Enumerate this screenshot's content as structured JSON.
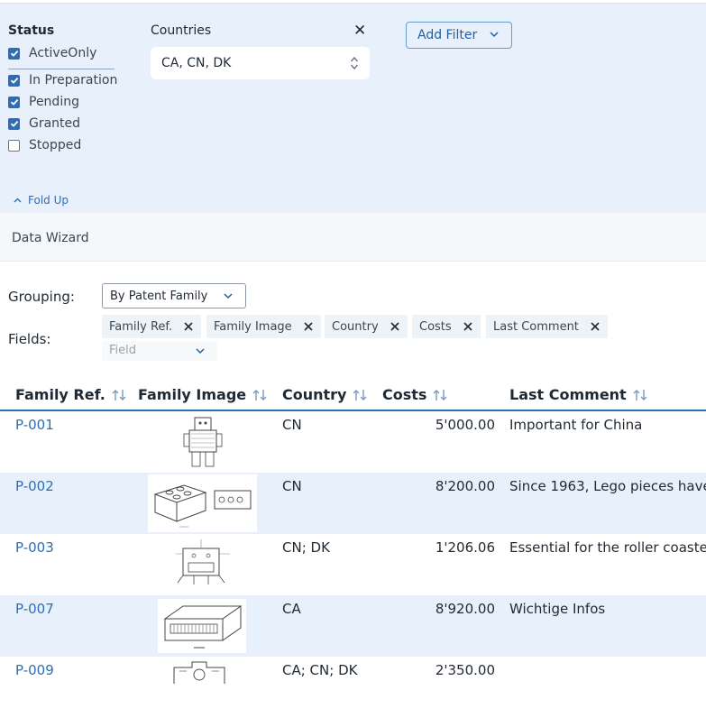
{
  "filters": {
    "status_title": "Status",
    "status_options": [
      {
        "label": "ActiveOnly",
        "checked": true
      },
      {
        "label": "In Preparation",
        "checked": true
      },
      {
        "label": "Pending",
        "checked": true
      },
      {
        "label": "Granted",
        "checked": true
      },
      {
        "label": "Stopped",
        "checked": false
      }
    ],
    "countries_title": "Countries",
    "countries_value": "CA, CN, DK",
    "add_filter_label": "Add Filter",
    "fold_up_label": "Fold Up"
  },
  "wizard": {
    "title": "Data Wizard",
    "grouping_label": "Grouping:",
    "grouping_value": "By Patent Family",
    "fields_label": "Fields:",
    "field_chips": [
      "Family Ref.",
      "Family Image",
      "Country",
      "Costs",
      "Last Comment"
    ],
    "field_placeholder": "Field"
  },
  "table": {
    "columns": [
      "Family Ref.",
      "Family Image",
      "Country",
      "Costs",
      "Last Comment"
    ],
    "rows": [
      {
        "ref": "P-001",
        "country": "CN",
        "costs": "5'000.00",
        "comment": "Important for China",
        "image": "robot-drawing"
      },
      {
        "ref": "P-002",
        "country": "CN",
        "costs": "8'200.00",
        "comment": "Since 1963, Lego pieces have",
        "image": "brick-drawing"
      },
      {
        "ref": "P-003",
        "country": "CN; DK",
        "costs": "1'206.06",
        "comment": "Essential for the roller coaste",
        "image": "cross-section-drawing"
      },
      {
        "ref": "P-007",
        "country": "CA",
        "costs": "8'920.00",
        "comment": "Wichtige Infos",
        "image": "block-drawing"
      },
      {
        "ref": "P-009",
        "country": "CA; CN; DK",
        "costs": "2'350.00",
        "comment": "",
        "image": "mechanism-drawing"
      }
    ]
  },
  "colors": {
    "accent": "#2e6db5",
    "panel_bg": "#e8f1fb",
    "row_alt": "#e8f1fb"
  }
}
